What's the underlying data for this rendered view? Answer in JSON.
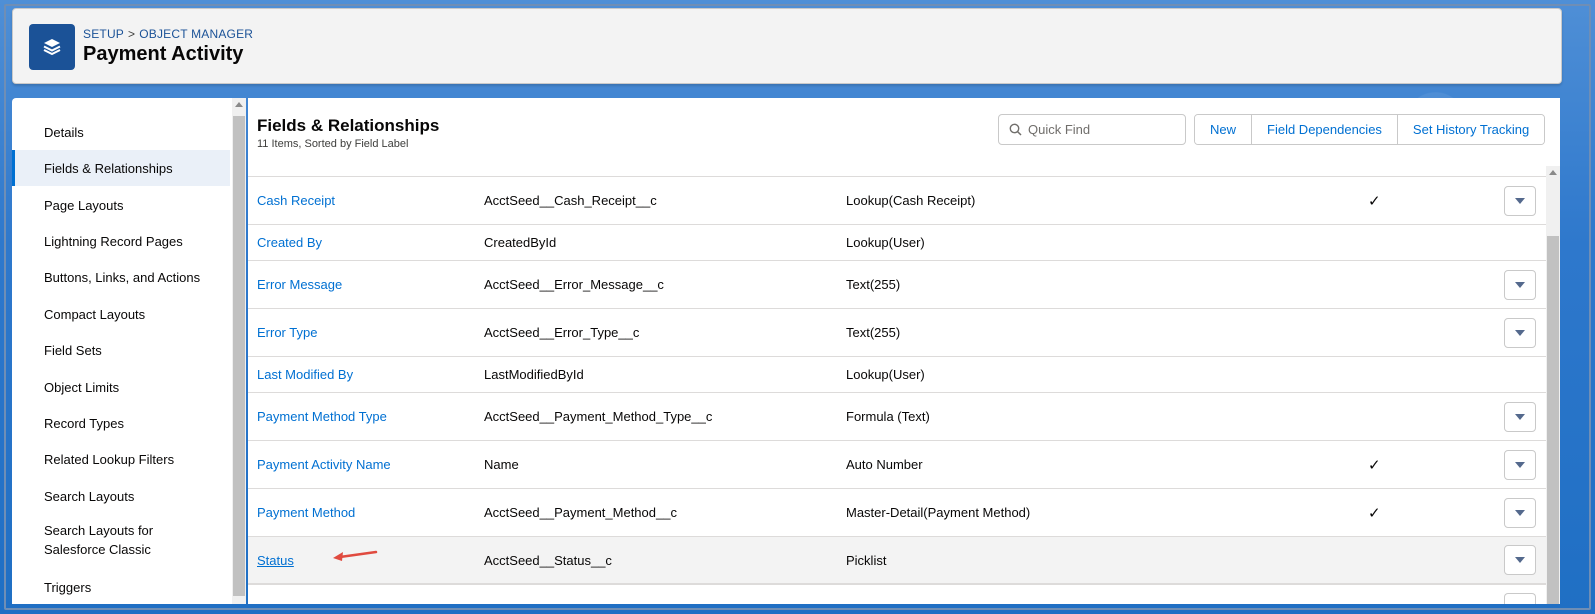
{
  "header": {
    "breadcrumb": [
      "SETUP",
      ">",
      "OBJECT MANAGER"
    ],
    "title": "Payment Activity",
    "app_icon": "layers-icon"
  },
  "sidebar": {
    "items": [
      {
        "label": "Details",
        "active": false
      },
      {
        "label": "Fields & Relationships",
        "active": true
      },
      {
        "label": "Page Layouts",
        "active": false
      },
      {
        "label": "Lightning Record Pages",
        "active": false
      },
      {
        "label": "Buttons, Links, and Actions",
        "active": false
      },
      {
        "label": "Compact Layouts",
        "active": false
      },
      {
        "label": "Field Sets",
        "active": false
      },
      {
        "label": "Object Limits",
        "active": false
      },
      {
        "label": "Record Types",
        "active": false
      },
      {
        "label": "Related Lookup Filters",
        "active": false
      },
      {
        "label": "Search Layouts",
        "active": false
      },
      {
        "label": "Search Layouts for Salesforce Classic",
        "active": false
      },
      {
        "label": "Triggers",
        "active": false
      }
    ]
  },
  "main": {
    "title": "Fields & Relationships",
    "subtitle": "11 Items, Sorted by Field Label",
    "search": {
      "placeholder": "Quick Find",
      "value": ""
    },
    "buttons": {
      "new": "New",
      "field_dependencies": "Field Dependencies",
      "set_history_tracking": "Set History Tracking"
    },
    "rows": [
      {
        "label": "Cash Receipt",
        "api": "AcctSeed__Cash_Receipt__c",
        "type": "Lookup(Cash Receipt)",
        "indexed": true,
        "menu": true
      },
      {
        "label": "Created By",
        "api": "CreatedById",
        "type": "Lookup(User)",
        "indexed": false,
        "menu": false
      },
      {
        "label": "Error Message",
        "api": "AcctSeed__Error_Message__c",
        "type": "Text(255)",
        "indexed": false,
        "menu": true
      },
      {
        "label": "Error Type",
        "api": "AcctSeed__Error_Type__c",
        "type": "Text(255)",
        "indexed": false,
        "menu": true
      },
      {
        "label": "Last Modified By",
        "api": "LastModifiedById",
        "type": "Lookup(User)",
        "indexed": false,
        "menu": false
      },
      {
        "label": "Payment Method Type",
        "api": "AcctSeed__Payment_Method_Type__c",
        "type": "Formula (Text)",
        "indexed": false,
        "menu": true
      },
      {
        "label": "Payment Activity Name",
        "api": "Name",
        "type": "Auto Number",
        "indexed": true,
        "menu": true
      },
      {
        "label": "Payment Method",
        "api": "AcctSeed__Payment_Method__c",
        "type": "Master-Detail(Payment Method)",
        "indexed": true,
        "menu": true
      },
      {
        "label": "Status",
        "api": "AcctSeed__Status__c",
        "type": "Picklist",
        "indexed": false,
        "menu": true,
        "highlighted": true
      }
    ]
  },
  "colors": {
    "link": "#0070d2",
    "app_icon_bg": "#1b5297",
    "annotation_arrow": "#e04a3f"
  }
}
